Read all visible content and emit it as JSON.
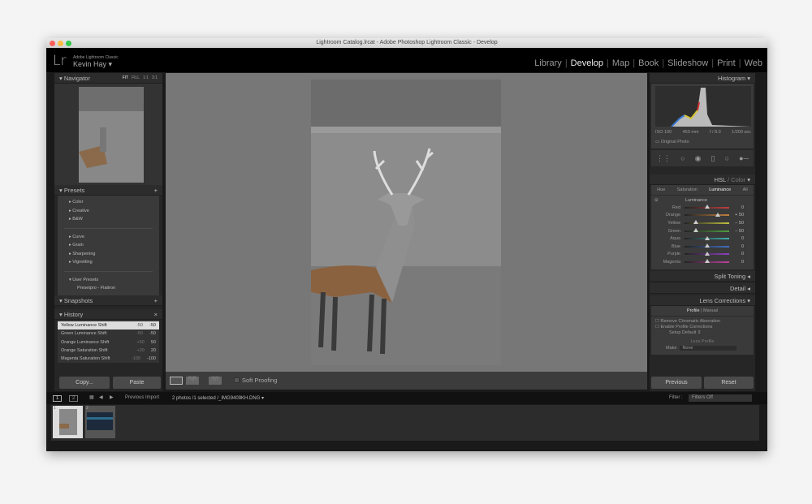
{
  "window": {
    "title": "Lightroom Catalog.lrcat - Adobe Photoshop Lightroom Classic - Develop"
  },
  "identity": {
    "logo": "Lr",
    "product": "Adobe Lightroom Classic",
    "user": "Kevin Hay"
  },
  "modules": [
    {
      "label": "Library"
    },
    {
      "label": "Develop",
      "active": true
    },
    {
      "label": "Map"
    },
    {
      "label": "Book"
    },
    {
      "label": "Slideshow"
    },
    {
      "label": "Print"
    },
    {
      "label": "Web"
    }
  ],
  "navigator": {
    "title": "Navigator",
    "zoom_options": [
      "FIT",
      "FILL",
      "1:1",
      "3:1"
    ]
  },
  "presets": {
    "title": "Presets",
    "groups": [
      [
        "Color",
        "Creative",
        "B&W"
      ],
      [
        "Curve",
        "Grain",
        "Sharpening",
        "Vignetting"
      ]
    ],
    "user_presets": "User Presets",
    "user_items": [
      "Presetpro - Flatiron"
    ]
  },
  "snapshots": {
    "title": "Snapshots"
  },
  "history": {
    "title": "History",
    "items": [
      {
        "label": "Yellow Luminance Shift",
        "a": "-50",
        "b": "-50",
        "selected": true
      },
      {
        "label": "Green Luminance Shift",
        "a": "-50",
        "b": "-50"
      },
      {
        "label": "Orange Luminance Shift",
        "a": "+50",
        "b": "50"
      },
      {
        "label": "Orange Saturation Shift",
        "a": "+20",
        "b": "20"
      },
      {
        "label": "Magenta Saturation Shift",
        "a": "-100",
        "b": "-100"
      }
    ]
  },
  "left_buttons": {
    "copy": "Copy...",
    "paste": "Paste"
  },
  "toolbar": {
    "soft_proofing": "Soft Proofing"
  },
  "histogram": {
    "title": "Histogram",
    "iso": "ISO 100",
    "focal": "450 mm",
    "aperture": "f / 8.0",
    "shutter": "1/200 sec",
    "original_photo": "Original Photo"
  },
  "hsl": {
    "title_a": "HSL",
    "title_b": "/ Color",
    "tabs": [
      "Hue",
      "Saturation",
      "Luminance",
      "All"
    ],
    "active_tab": "Luminance",
    "section": "Luminance",
    "sliders": [
      {
        "label": "Red",
        "value": 0,
        "display": "0",
        "color": "#c04040"
      },
      {
        "label": "Orange",
        "value": 50,
        "display": "+ 50",
        "color": "#c08040"
      },
      {
        "label": "Yellow",
        "value": -50,
        "display": "− 50",
        "color": "#c0c040"
      },
      {
        "label": "Green",
        "value": -50,
        "display": "− 50",
        "color": "#50a040"
      },
      {
        "label": "Aqua",
        "value": 0,
        "display": "0",
        "color": "#40b0b0"
      },
      {
        "label": "Blue",
        "value": 0,
        "display": "0",
        "color": "#4070c0"
      },
      {
        "label": "Purple",
        "value": 0,
        "display": "0",
        "color": "#9040c0"
      },
      {
        "label": "Magenta",
        "value": 0,
        "display": "0",
        "color": "#c040a0"
      }
    ]
  },
  "collapsed_panels": [
    "Split Toning",
    "Detail"
  ],
  "lens": {
    "title": "Lens Corrections",
    "tabs": [
      "Profile",
      "Manual"
    ],
    "checks": [
      "Remove Chromatic Aberration",
      "Enable Profile Corrections"
    ],
    "setup_label": "Setup",
    "setup_value": "Default",
    "lens_profile": "Lens Profile",
    "make_label": "Make",
    "make_value": "None"
  },
  "right_buttons": {
    "previous": "Previous",
    "reset": "Reset"
  },
  "filmstrip": {
    "views": [
      "1",
      "2"
    ],
    "source": "Previous Import",
    "info": "2 photos /1 selected /_IMG9409KH.DNG",
    "filter_label": "Filter :",
    "filter_value": "Filters Off",
    "thumb_numbers": [
      "1",
      "2"
    ]
  }
}
